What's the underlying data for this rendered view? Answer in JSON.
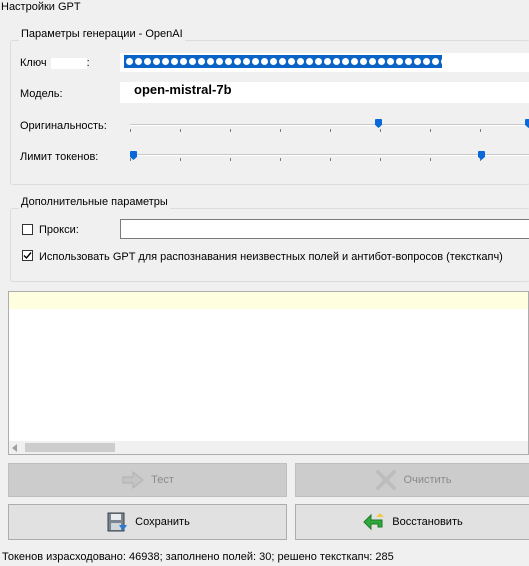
{
  "window": {
    "title": "Настройки GPT"
  },
  "generation": {
    "legend": "Параметры генерации - OpenAI",
    "key_label": "Ключ",
    "key_masked": "●●●●●●●●●●●●●●●●●●●●●●●●●●●●●●●●●●●●●●●●●●●●●●",
    "model_label": "Модель:",
    "model_value": "open-mistral-7b",
    "originality_label": "Оригинальность:",
    "originality_level": 0.62,
    "tokens_label": "Лимит токенов:",
    "tokens_level": 0.0
  },
  "extra": {
    "legend": "Дополнительные параметры",
    "proxy_label": "Прокси:",
    "proxy_checked": false,
    "proxy_value": "",
    "use_gpt_label": "Использовать GPT для распознавания неизвестных полей и антибот-вопросов (тексткапч)",
    "use_gpt_checked": true
  },
  "log": {
    "text": ""
  },
  "buttons": {
    "test": "Тест",
    "clear": "Очистить",
    "save": "Сохранить",
    "restore": "Восстановить"
  },
  "status": {
    "text": "Токенов израсходовано: 46938; заполнено полей: 30; решено тексткапч: 285"
  },
  "colors": {
    "background": "#f0f0f0",
    "selection": "#0a64c8",
    "slider_thumb": "#0a68d8",
    "log_highlight": "#ffffe0"
  }
}
